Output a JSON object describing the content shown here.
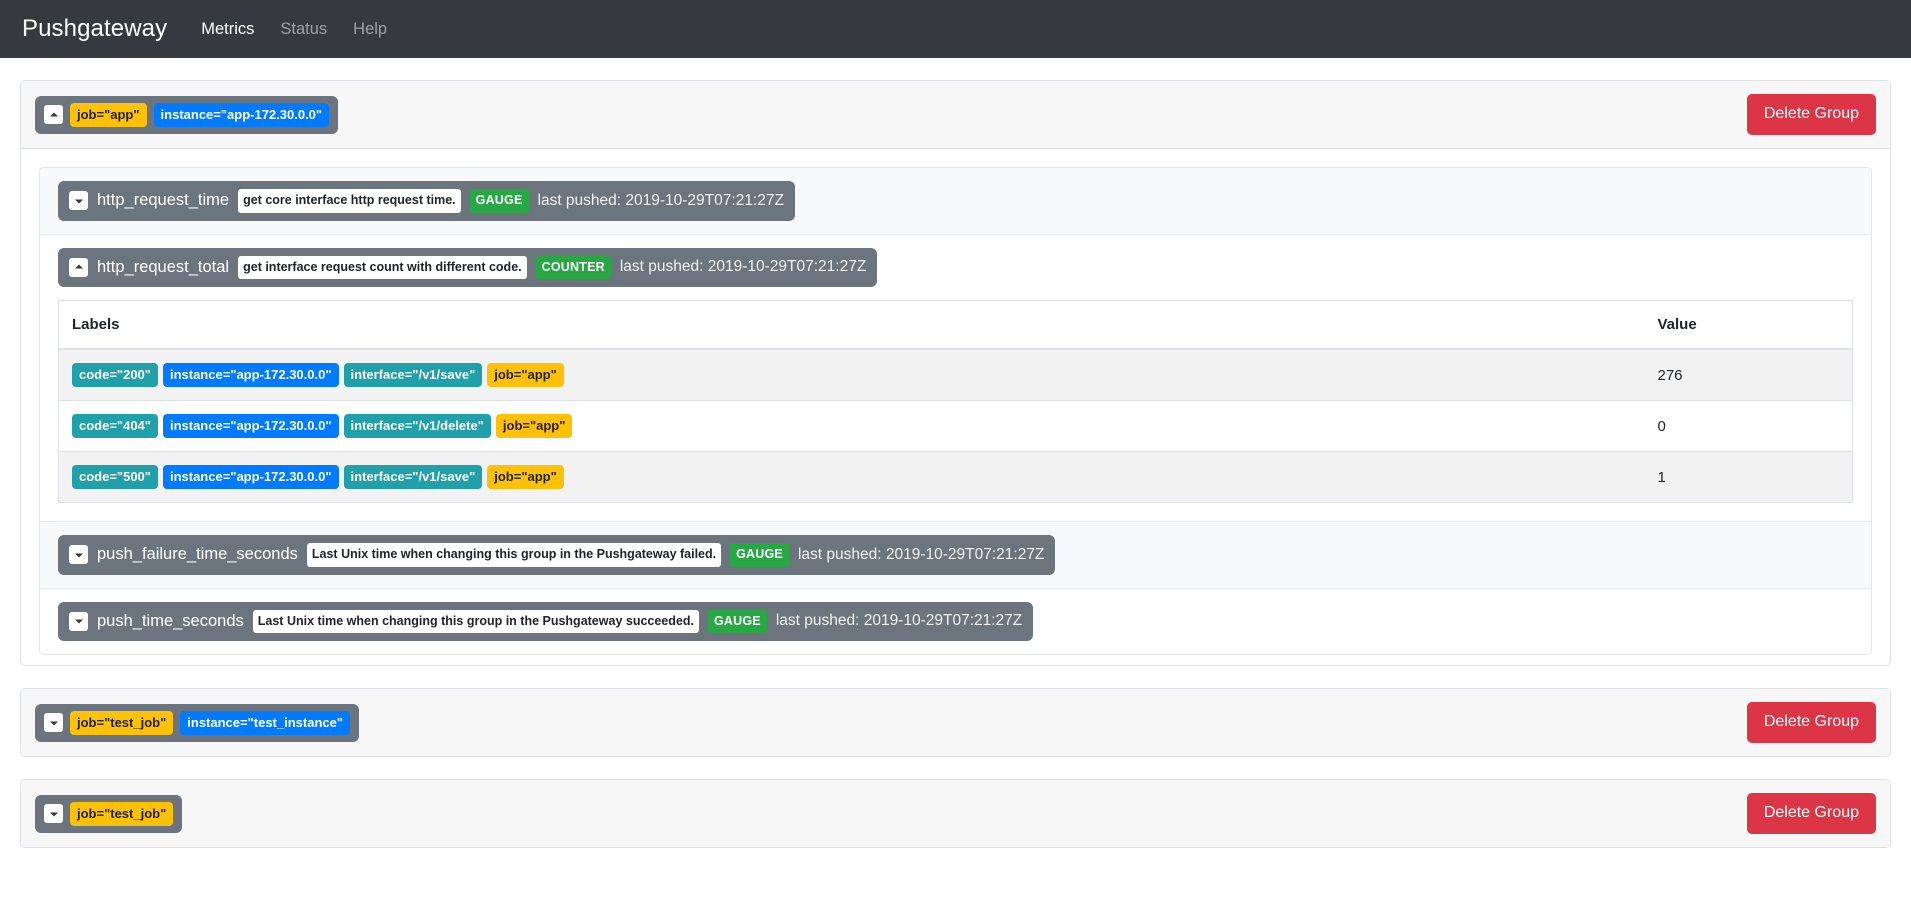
{
  "navbar": {
    "brand": "Pushgateway",
    "links": [
      {
        "label": "Metrics",
        "active": true
      },
      {
        "label": "Status",
        "active": false
      },
      {
        "label": "Help",
        "active": false
      }
    ]
  },
  "delete_button_label": "Delete Group",
  "table_headers": {
    "labels": "Labels",
    "value": "Value"
  },
  "colors": {
    "navbar_bg": "#343a40",
    "chip_bg": "#6c757d",
    "badge_job": "#ffc107",
    "badge_instance": "#007bff",
    "badge_teal": "#20a0a8",
    "type_gauge": "#28a745",
    "delete_red": "#dc3545"
  },
  "groups": [
    {
      "expanded": true,
      "toggle_icon": "chevron-up-icon",
      "labels": [
        {
          "text": "job=\"app\"",
          "kind": "job"
        },
        {
          "text": "instance=\"app-172.30.0.0\"",
          "kind": "instance"
        }
      ],
      "metrics": [
        {
          "name": "http_request_time",
          "help": "get core interface http request time.",
          "type": "GAUGE",
          "pushed": "last pushed: 2019-10-29T07:21:27Z",
          "expanded": false,
          "toggle_icon": "chevron-down-icon",
          "shaded": true,
          "rows": []
        },
        {
          "name": "http_request_total",
          "help": "get interface request count with different code.",
          "type": "COUNTER",
          "pushed": "last pushed: 2019-10-29T07:21:27Z",
          "expanded": true,
          "toggle_icon": "chevron-up-icon",
          "shaded": false,
          "rows": [
            {
              "labels": [
                {
                  "text": "code=\"200\"",
                  "kind": "teal"
                },
                {
                  "text": "instance=\"app-172.30.0.0\"",
                  "kind": "instance"
                },
                {
                  "text": "interface=\"/v1/save\"",
                  "kind": "teal"
                },
                {
                  "text": "job=\"app\"",
                  "kind": "job"
                }
              ],
              "value": "276"
            },
            {
              "labels": [
                {
                  "text": "code=\"404\"",
                  "kind": "teal"
                },
                {
                  "text": "instance=\"app-172.30.0.0\"",
                  "kind": "instance"
                },
                {
                  "text": "interface=\"/v1/delete\"",
                  "kind": "teal"
                },
                {
                  "text": "job=\"app\"",
                  "kind": "job"
                }
              ],
              "value": "0"
            },
            {
              "labels": [
                {
                  "text": "code=\"500\"",
                  "kind": "teal"
                },
                {
                  "text": "instance=\"app-172.30.0.0\"",
                  "kind": "instance"
                },
                {
                  "text": "interface=\"/v1/save\"",
                  "kind": "teal"
                },
                {
                  "text": "job=\"app\"",
                  "kind": "job"
                }
              ],
              "value": "1"
            }
          ]
        },
        {
          "name": "push_failure_time_seconds",
          "help": "Last Unix time when changing this group in the Pushgateway failed.",
          "type": "GAUGE",
          "pushed": "last pushed: 2019-10-29T07:21:27Z",
          "expanded": false,
          "toggle_icon": "chevron-down-icon",
          "shaded": true,
          "rows": []
        },
        {
          "name": "push_time_seconds",
          "help": "Last Unix time when changing this group in the Pushgateway succeeded.",
          "type": "GAUGE",
          "pushed": "last pushed: 2019-10-29T07:21:27Z",
          "expanded": false,
          "toggle_icon": "chevron-down-icon",
          "shaded": false,
          "rows": []
        }
      ]
    },
    {
      "expanded": false,
      "toggle_icon": "chevron-down-icon",
      "labels": [
        {
          "text": "job=\"test_job\"",
          "kind": "job"
        },
        {
          "text": "instance=\"test_instance\"",
          "kind": "instance"
        }
      ],
      "metrics": []
    },
    {
      "expanded": false,
      "toggle_icon": "chevron-down-icon",
      "labels": [
        {
          "text": "job=\"test_job\"",
          "kind": "job"
        }
      ],
      "metrics": []
    }
  ]
}
